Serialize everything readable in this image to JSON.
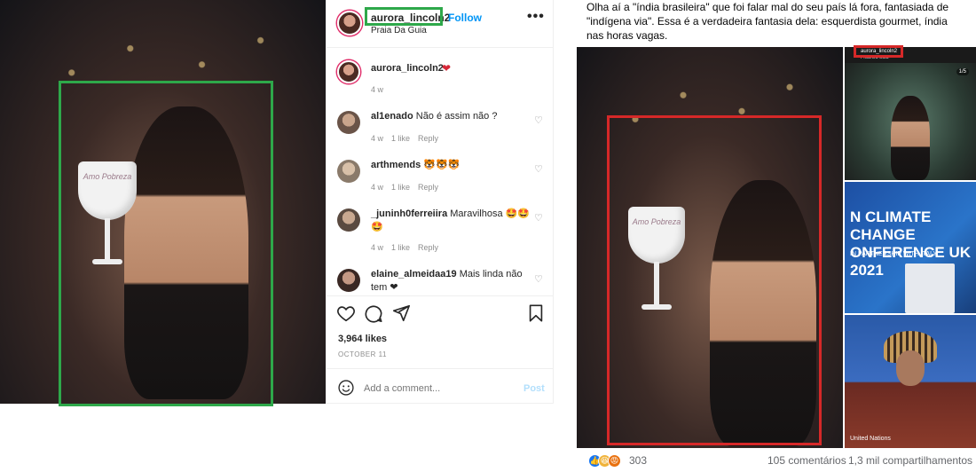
{
  "instagram": {
    "header": {
      "username": "aurora_lincoln2",
      "follow_label": "Follow",
      "location": "Praia Da Guia",
      "more_label": "•••"
    },
    "photo": {
      "cup_text": "Amo Pobreza"
    },
    "caption": {
      "username": "aurora_lincoln2",
      "emoji": "❤",
      "time": "4 w"
    },
    "comments": [
      {
        "username": "al1enado",
        "text": "Não é assim não ?",
        "time": "4 w",
        "likes": "1 like",
        "reply": "Reply"
      },
      {
        "username": "arthmends",
        "text": "🐯🐯🐯",
        "time": "4 w",
        "likes": "1 like",
        "reply": "Reply"
      },
      {
        "username": "_juninh0ferreiira",
        "text": "Maravilhosa 🤩🤩🤩",
        "time": "4 w",
        "likes": "1 like",
        "reply": "Reply"
      },
      {
        "username": "elaine_almeidaa19",
        "text": "Mais linda não tem ❤"
      }
    ],
    "likes_count": "3,964 likes",
    "date": "OCTOBER 11",
    "add_comment_placeholder": "Add a comment...",
    "post_label": "Post"
  },
  "facebook": {
    "post_text": "Olha aí a \"índia brasileira\" que foi falar mal do seu país lá fora, fantasiada de \"indígena via\". Essa é a verdadeira fantasia dela: esquerdista gourmet, índia nas horas vagas.",
    "thumb1": {
      "username": "aurora_lincoln2",
      "location": "Praia Da Guia",
      "counter": "1/5"
    },
    "thumb2": {
      "headline_line1": "N CLIMATE CHANGE",
      "headline_line2": "ONFERENCE UK 2021",
      "footer": "IN PARTNERSHIP WITH ITALY"
    },
    "thumb3": {
      "footer": "United Nations"
    },
    "reactions_count": "303",
    "comments_count": "105 comentários",
    "shares_count": "1,3 mil compartilhamentos"
  },
  "colors": {
    "green_box": "#2ea84a",
    "red_box": "#d62828",
    "follow_blue": "#0095f6"
  }
}
